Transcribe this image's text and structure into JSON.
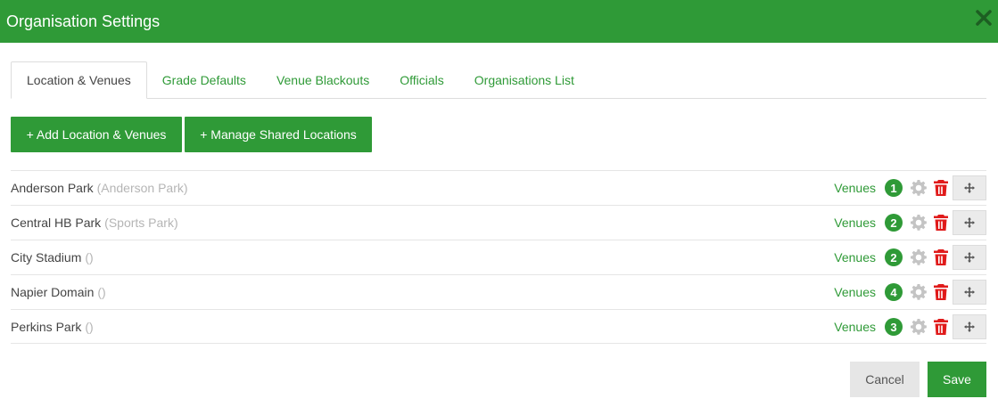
{
  "dialog": {
    "title": "Organisation Settings"
  },
  "tabs": [
    {
      "label": "Location & Venues",
      "active": true
    },
    {
      "label": "Grade Defaults",
      "active": false
    },
    {
      "label": "Venue Blackouts",
      "active": false
    },
    {
      "label": "Officials",
      "active": false
    },
    {
      "label": "Organisations List",
      "active": false
    }
  ],
  "actions": {
    "add_label": "+ Add Location & Venues",
    "manage_label": "+ Manage Shared Locations"
  },
  "locations": [
    {
      "name": "Anderson Park",
      "sub": "(Anderson Park)",
      "venues_label": "Venues",
      "count": "1"
    },
    {
      "name": "Central HB Park",
      "sub": "(Sports Park)",
      "venues_label": "Venues",
      "count": "2"
    },
    {
      "name": "City Stadium",
      "sub": "()",
      "venues_label": "Venues",
      "count": "2"
    },
    {
      "name": "Napier Domain",
      "sub": "()",
      "venues_label": "Venues",
      "count": "4"
    },
    {
      "name": "Perkins Park",
      "sub": "()",
      "venues_label": "Venues",
      "count": "3"
    }
  ],
  "footer": {
    "cancel_label": "Cancel",
    "save_label": "Save"
  },
  "icons": {
    "close": "close-icon",
    "gear": "gear-icon",
    "trash": "trash-icon",
    "move": "move-icon"
  },
  "colors": {
    "brand_green": "#2f9a37",
    "delete_red": "#e01b1b",
    "muted_gray": "#b5b5b5"
  }
}
